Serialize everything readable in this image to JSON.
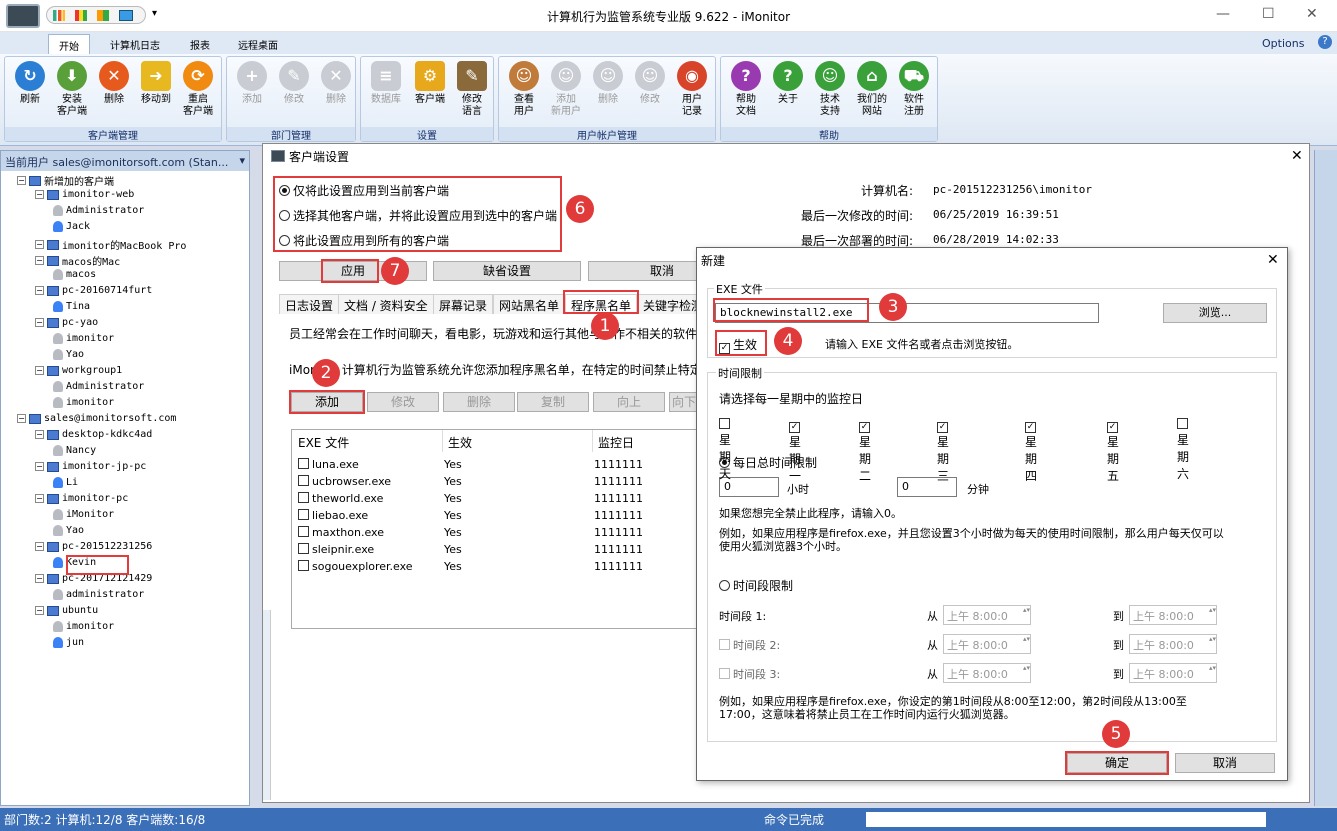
{
  "window": {
    "title": "计算机行为监管系统专业版 9.622 - iMonitor",
    "options": "Options"
  },
  "ribbon_tabs": [
    "开始",
    "计算机日志",
    "报表",
    "远程桌面"
  ],
  "groups": [
    {
      "label": "客户端管理",
      "buttons": [
        "刷新",
        "安装\n客户端",
        "删除",
        "移动到",
        "重启\n客户端"
      ]
    },
    {
      "label": "部门管理",
      "buttons": [
        "添加",
        "修改",
        "删除"
      ]
    },
    {
      "label": "设置",
      "buttons": [
        "数据库",
        "客户端",
        "修改\n语言"
      ]
    },
    {
      "label": "用户帐户管理",
      "buttons": [
        "查看\n用户",
        "添加\n新用户",
        "删除",
        "修改",
        "用户\n记录"
      ]
    },
    {
      "label": "帮助",
      "buttons": [
        "帮助\n文档",
        "关于",
        "技术\n支持",
        "我们的\n网站",
        "软件\n注册"
      ]
    }
  ],
  "left": {
    "header": "当前用户 sales@imonitorsoft.com (Stan...",
    "tree": [
      {
        "t": "新增加的客户端",
        "k": "grp",
        "d": 0
      },
      {
        "t": "imonitor-web",
        "k": "pc",
        "d": 1
      },
      {
        "t": "Administrator",
        "k": "ug",
        "d": 2
      },
      {
        "t": "Jack",
        "k": "u",
        "d": 2
      },
      {
        "t": "imonitor的MacBook Pro",
        "k": "pc",
        "d": 1
      },
      {
        "t": "macos的Mac",
        "k": "pc",
        "d": 1
      },
      {
        "t": "macos",
        "k": "ug",
        "d": 2
      },
      {
        "t": "pc-20160714furt",
        "k": "pc",
        "d": 1
      },
      {
        "t": "Tina",
        "k": "u",
        "d": 2
      },
      {
        "t": "pc-yao",
        "k": "pc",
        "d": 1
      },
      {
        "t": "imonitor",
        "k": "ug",
        "d": 2
      },
      {
        "t": "Yao",
        "k": "ug",
        "d": 2
      },
      {
        "t": "workgroup1",
        "k": "pc",
        "d": 1
      },
      {
        "t": "Administrator",
        "k": "ug",
        "d": 2
      },
      {
        "t": "imonitor",
        "k": "ug",
        "d": 2
      },
      {
        "t": "sales@imonitorsoft.com",
        "k": "grp",
        "d": 0
      },
      {
        "t": "desktop-kdkc4ad",
        "k": "pc",
        "d": 1
      },
      {
        "t": "Nancy",
        "k": "ug",
        "d": 2
      },
      {
        "t": "imonitor-jp-pc",
        "k": "pc",
        "d": 1
      },
      {
        "t": "Li",
        "k": "u",
        "d": 2
      },
      {
        "t": "imonitor-pc",
        "k": "pc",
        "d": 1
      },
      {
        "t": "iMonitor",
        "k": "ug",
        "d": 2
      },
      {
        "t": "Yao",
        "k": "ug",
        "d": 2
      },
      {
        "t": "pc-201512231256",
        "k": "pc",
        "d": 1
      },
      {
        "t": "Kevin",
        "k": "u",
        "d": 2
      },
      {
        "t": "pc-201712121429",
        "k": "pc",
        "d": 1
      },
      {
        "t": "administrator",
        "k": "ug",
        "d": 2
      },
      {
        "t": "ubuntu",
        "k": "pc",
        "d": 1
      },
      {
        "t": "imonitor",
        "k": "ug",
        "d": 2
      },
      {
        "t": "jun",
        "k": "u",
        "d": 2
      }
    ]
  },
  "status": {
    "left": "部门数:2 计算机:12/8 客户端数:16/8",
    "right": "命令已完成"
  },
  "settings": {
    "title": "客户端设置",
    "radios": [
      "仅将此设置应用到当前客户端",
      "选择其他客户端，并将此设置应用到选中的客户端",
      "将此设置应用到所有的客户端"
    ],
    "info": [
      {
        "k": "计算机名:",
        "v": "pc-201512231256\\imonitor"
      },
      {
        "k": "最后一次修改的时间:",
        "v": "06/25/2019 16:39:51"
      },
      {
        "k": "最后一次部署的时间:",
        "v": "06/28/2019 14:02:33"
      }
    ],
    "apply": "应用",
    "default": "缺省设置",
    "cancel": "取消",
    "tabs": [
      "日志设置",
      "文档 / 资料安全",
      "屏幕记录",
      "网站黑名单",
      "程序黑名单",
      "关键字检测"
    ],
    "desc1": "员工经常会在工作时间聊天，看电影，玩游戏和运行其他与工作不相关的软件，",
    "desc2": "iMonitor 计算机行为监管系统允许您添加程序黑名单，在特定的时间禁止特定的",
    "actions": [
      "添加",
      "修改",
      "删除",
      "复制",
      "向上",
      "向下"
    ],
    "cols": [
      "EXE 文件",
      "生效",
      "监控日"
    ],
    "rows": [
      [
        "luna.exe",
        "Yes",
        "1111111"
      ],
      [
        "ucbrowser.exe",
        "Yes",
        "1111111"
      ],
      [
        "theworld.exe",
        "Yes",
        "1111111"
      ],
      [
        "liebao.exe",
        "Yes",
        "1111111"
      ],
      [
        "maxthon.exe",
        "Yes",
        "1111111"
      ],
      [
        "sleipnir.exe",
        "Yes",
        "1111111"
      ],
      [
        "sogouexplorer.exe",
        "Yes",
        "1111111"
      ]
    ]
  },
  "newdlg": {
    "title": "新建",
    "exe_legend": "EXE 文件",
    "exe_value": "blocknewinstall2.exe",
    "browse": "浏览...",
    "effective": "生效",
    "hint": "请输入 EXE 文件名或者点击浏览按钮。",
    "time_legend": "时间限制",
    "choose_days": "请选择每一星期中的监控日",
    "days": [
      {
        "d": "星期天",
        "c": false
      },
      {
        "d": "星期一",
        "c": true
      },
      {
        "d": "星期二",
        "c": true
      },
      {
        "d": "星期三",
        "c": true
      },
      {
        "d": "星期四",
        "c": true
      },
      {
        "d": "星期五",
        "c": true
      },
      {
        "d": "星期六",
        "c": false
      }
    ],
    "daily": "每日总时间限制",
    "hours": "0",
    "hours_unit": "小时",
    "minutes": "0",
    "minutes_unit": "分钟",
    "zero_hint": "如果您想完全禁止此程序，请输入0。",
    "example1": "例如，如果应用程序是firefox.exe，并且您设置3个小时做为每天的使用时间限制，那么用户每天仅可以使用火狐浏览器3个小时。",
    "period": "时间段限制",
    "periods": [
      "时间段 1:",
      "时间段 2:",
      "时间段 3:"
    ],
    "from": "从",
    "to": "到",
    "time_val": "上午  8:00:0",
    "example2": "例如，如果应用程序是firefox.exe，你设定的第1时间段从8:00至12:00，第2时间段从13:00至17:00，这意味着将禁止员工在工作时间内运行火狐浏览器。",
    "ok": "确定",
    "cancel": "取消"
  },
  "badges": [
    "1",
    "2",
    "3",
    "4",
    "5",
    "6",
    "7"
  ]
}
